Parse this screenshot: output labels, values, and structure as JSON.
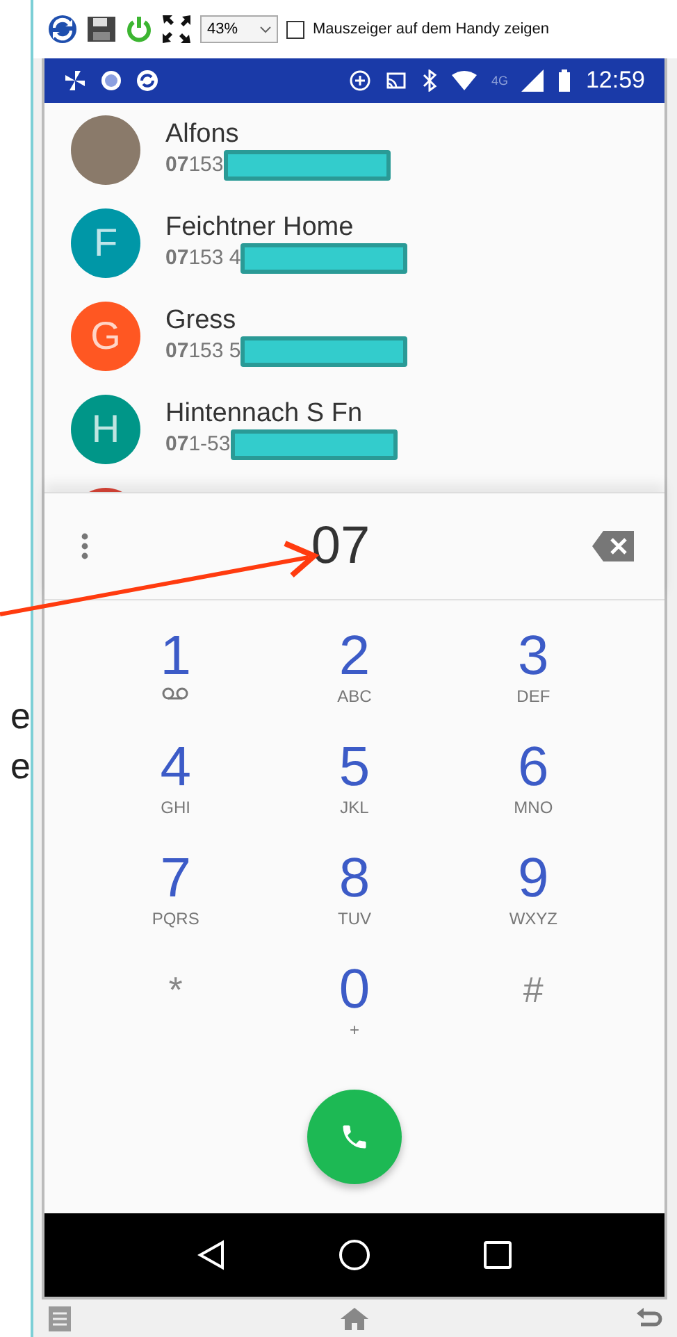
{
  "toolbar": {
    "zoom": "43%",
    "checkbox": {
      "label": "Mauszeiger auf dem Handy zeigen",
      "checked": false
    }
  },
  "status_bar": {
    "network": "4G",
    "time": "12:59"
  },
  "contacts": [
    {
      "kind": "photo",
      "name": "Alfons",
      "number": "**07**153"
    },
    {
      "kind": "letter",
      "letter": "F",
      "color": "#0097a7",
      "name": "Feichtner Home",
      "number": "**07**153 4"
    },
    {
      "kind": "letter",
      "letter": "G",
      "color": "#ff5722",
      "name": "Gress",
      "number": "**07**153 5"
    },
    {
      "kind": "letter",
      "letter": "H",
      "color": "#009688",
      "name": "Hintennach S Fn",
      "number": "**07**1-53"
    },
    {
      "kind": "partial",
      "color": "#db4437"
    }
  ],
  "dialer": {
    "digits": "07",
    "keys": [
      {
        "kind": "voicemail",
        "digit": "1"
      },
      {
        "kind": "letters",
        "digit": "2",
        "sub": "ABC"
      },
      {
        "kind": "letters",
        "digit": "3",
        "sub": "DEF"
      },
      {
        "kind": "letters",
        "digit": "4",
        "sub": "GHI"
      },
      {
        "kind": "letters",
        "digit": "5",
        "sub": "JKL"
      },
      {
        "kind": "letters",
        "digit": "6",
        "sub": "MNO"
      },
      {
        "kind": "letters",
        "digit": "7",
        "sub": "PQRS"
      },
      {
        "kind": "letters",
        "digit": "8",
        "sub": "TUV"
      },
      {
        "kind": "letters",
        "digit": "9",
        "sub": "WXYZ"
      },
      {
        "kind": "symbol",
        "digit": "*"
      },
      {
        "kind": "letters",
        "digit": "0",
        "sub": "+"
      },
      {
        "kind": "symbol",
        "digit": "#"
      }
    ]
  },
  "annotation": {
    "fragments": [
      "e",
      "e"
    ]
  }
}
